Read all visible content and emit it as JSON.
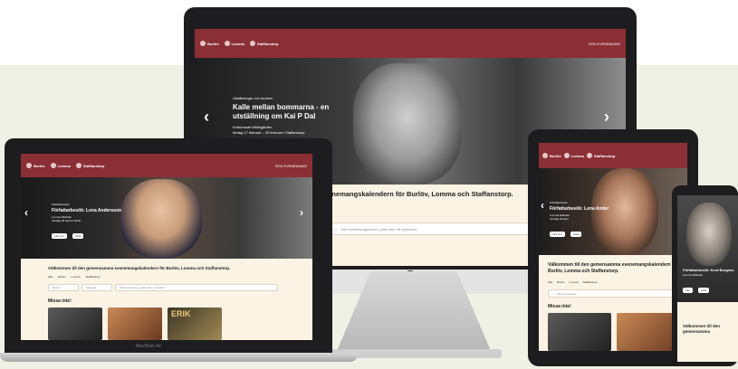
{
  "brand": {
    "municipality_1": "Burlöv",
    "municipality_2": "Lomma",
    "municipality_3": "Staffanstorp",
    "accent": "#8a2f35",
    "cream": "#fbf3e3"
  },
  "header": {
    "menu_label": "SÖK EVENEMANG"
  },
  "imac": {
    "hero_kicker": "Utställningar och museer",
    "hero_title": "Kalle mellan bommarna - en utställning om Kai P Dal",
    "hero_location": "Kulturhuset Möllegården",
    "hero_dates": "lördag 17 februari – 29 februari i Staffanstorp",
    "intro_text": "ma evenemangskalendern för Burlöv, Lomma och Staffanstorp.",
    "intro_sub": "evenemang",
    "search_placeholder": "Sök evenemangsnamn, plats eller ett nyckelord"
  },
  "macbook": {
    "hero_kicker": "Författarbesök",
    "hero_title": "Författarbesök: Lena Andersson",
    "hero_location": "Lomma bibliotek",
    "hero_dates": "torsdag 18 april kl 18.00",
    "btn_read": "Läs mer",
    "btn_share": "Dela",
    "welcome": "Välkommen till den gemensamma evenemangskalendern för Burlöv, Lomma och Staffanstorp.",
    "filters": [
      "Alla",
      "Burlöv",
      "Lomma",
      "Staffanstorp"
    ],
    "chip_date": "Datum",
    "chip_category": "Kategori",
    "search_placeholder": "Sök evenemang, plats eller nyckelord",
    "section_title": "Missa inte!",
    "poster_text": "ERIK",
    "label": "MacBook Air"
  },
  "ipad": {
    "hero_kicker": "Författarbesök",
    "hero_title": "Författarbesök: Lena Ander",
    "hero_location": "Lomma bibliotek",
    "hero_dates": "torsdag 18 april",
    "btn_read": "Läs mer",
    "btn_share": "Dela",
    "welcome": "Välkommen till den gemensamma evenemangskalendern för Burlöv, Lomma och Staffanstorp.",
    "filters": [
      "Alla",
      "Burlöv",
      "Lomma",
      "Staffanstorp"
    ],
    "search_placeholder": "Sök evenemang",
    "section_title": "Missa inte!"
  },
  "iphone": {
    "hero_title": "Författarbesök: Kent Burgess",
    "hero_sub": "Lomma bibliotek",
    "btn_read": "Läs",
    "btn_share": "Dela",
    "welcome": "Välkommen till den gemensamma"
  }
}
